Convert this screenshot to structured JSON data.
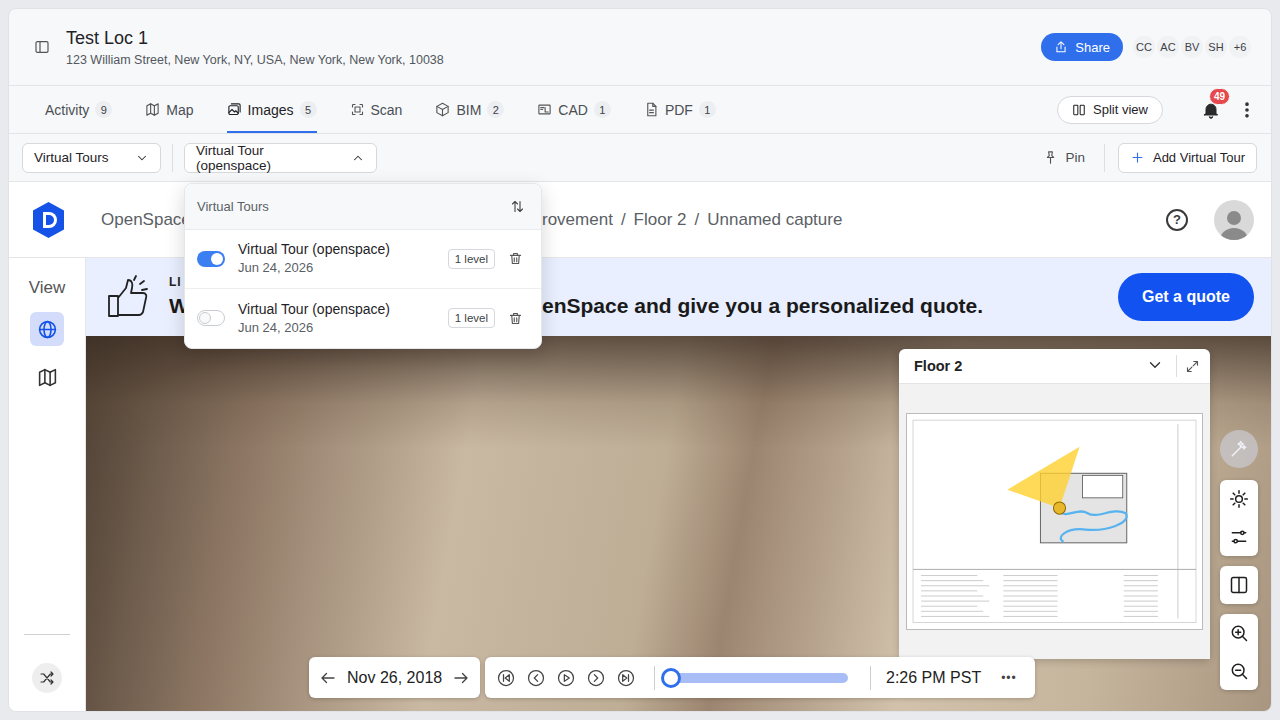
{
  "header": {
    "title": "Test Loc 1",
    "address": "123 William Street, New York, NY, USA, New York, New York, 10038",
    "share": "Share",
    "avatars": [
      "CC",
      "AC",
      "BV",
      "SH",
      "+6"
    ]
  },
  "tabs": [
    {
      "label": "Activity",
      "count": "9",
      "selected": false
    },
    {
      "label": "Map",
      "selected": false
    },
    {
      "label": "Images",
      "count": "5",
      "selected": true
    },
    {
      "label": "Scan",
      "selected": false
    },
    {
      "label": "BIM",
      "count": "2",
      "selected": false
    },
    {
      "label": "CAD",
      "count": "1",
      "selected": false
    },
    {
      "label": "PDF",
      "count": "1",
      "selected": false
    }
  ],
  "actions": {
    "split_view": "Split view",
    "notifications": "49"
  },
  "toolbar": {
    "view_select": "Virtual Tours",
    "tour_select": {
      "label": "Virtual Tour (openspace)",
      "expanded": true
    },
    "pin": "Pin",
    "add": "Add Virtual Tour"
  },
  "dropdown": {
    "title": "Virtual Tours",
    "items": [
      {
        "name": "Virtual Tour (openspace)",
        "date": "Jun 24, 2026",
        "levels": "1 level",
        "on": true
      },
      {
        "name": "Virtual Tour (openspace)",
        "date": "Jun 24, 2026",
        "levels": "1 level",
        "on": false
      }
    ]
  },
  "viewer": {
    "breadcrumb": {
      "root": "OpenSpace",
      "items": [
        "rovement",
        "Floor 2",
        "Unnamed capture"
      ],
      "separator": "/"
    },
    "help": "?",
    "rail": {
      "title": "View",
      "items": [
        {
          "selected": true
        },
        {
          "selected": false
        }
      ]
    },
    "banner": {
      "eyebrow": "LI",
      "headline_start": "W",
      "headline_end": "enSpace and give you a personalized quote.",
      "cta": "Get a quote"
    },
    "minimap": {
      "floor": "Floor 2"
    },
    "tools": [
      {
        "disabled": true
      },
      {
        "disabled": false
      },
      {
        "disabled": false
      },
      {
        "disabled": false
      },
      {
        "disabled": false
      },
      {
        "disabled": false
      }
    ],
    "timeline": {
      "date": "Nov 26, 2018",
      "level": 0,
      "time": "2:26 PM PST",
      "more": "•••"
    }
  }
}
